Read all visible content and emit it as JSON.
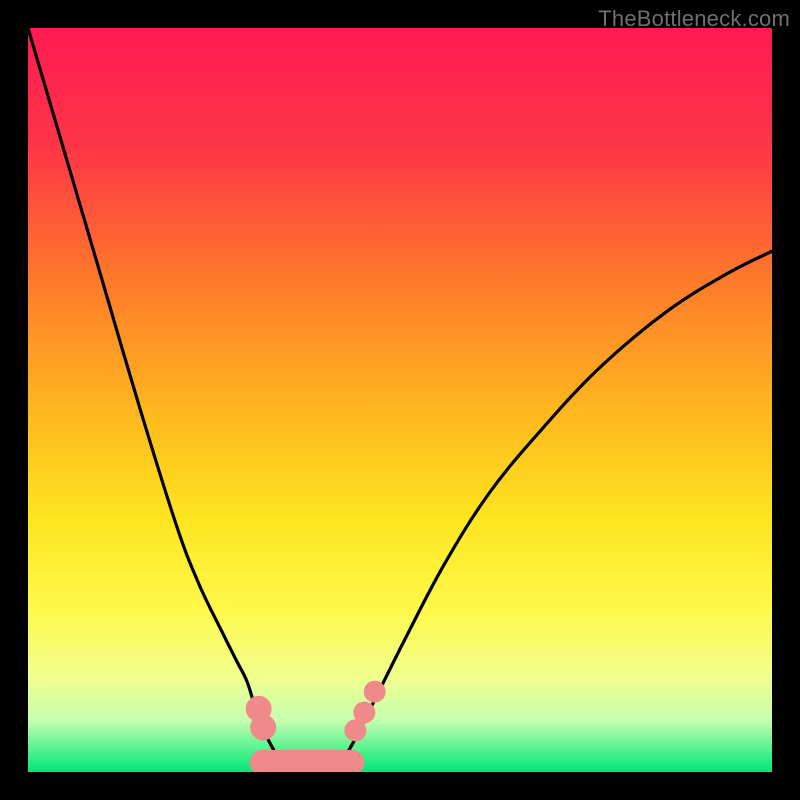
{
  "watermark": "TheBottleneck.com",
  "chart_data": {
    "type": "line",
    "title": "",
    "xlabel": "",
    "ylabel": "",
    "xlim": [
      0,
      1
    ],
    "ylim": [
      0,
      1
    ],
    "background_gradient": {
      "colors": [
        "#ff1a52",
        "#ff6a2e",
        "#ffcf1f",
        "#fff33a",
        "#f4ff8f",
        "#00e676"
      ],
      "direction": "top-to-bottom"
    },
    "series": [
      {
        "name": "left-curve",
        "x": [
          0.0,
          0.05,
          0.1,
          0.15,
          0.2,
          0.23,
          0.26,
          0.28,
          0.295,
          0.31,
          0.33,
          0.345
        ],
        "y": [
          1.0,
          0.83,
          0.66,
          0.49,
          0.33,
          0.252,
          0.19,
          0.15,
          0.12,
          0.072,
          0.03,
          0.01
        ]
      },
      {
        "name": "bottom-flat",
        "x": [
          0.345,
          0.42
        ],
        "y": [
          0.01,
          0.01
        ]
      },
      {
        "name": "right-curve",
        "x": [
          0.42,
          0.44,
          0.47,
          0.51,
          0.56,
          0.62,
          0.69,
          0.77,
          0.86,
          0.94,
          1.0
        ],
        "y": [
          0.01,
          0.045,
          0.105,
          0.185,
          0.28,
          0.375,
          0.46,
          0.545,
          0.62,
          0.67,
          0.7
        ]
      }
    ],
    "markers": {
      "name": "pink-beads",
      "color": "#f08a8a",
      "shape": "circle",
      "points": [
        {
          "x": 0.31,
          "y": 0.085,
          "r": 13
        },
        {
          "x": 0.316,
          "y": 0.06,
          "r": 13
        },
        {
          "x": 0.44,
          "y": 0.056,
          "r": 11
        },
        {
          "x": 0.452,
          "y": 0.08,
          "r": 11
        },
        {
          "x": 0.466,
          "y": 0.108,
          "r": 11
        }
      ],
      "bottom_band": {
        "x0": 0.315,
        "x1": 0.435,
        "y": 0.01,
        "thickness": 0.034
      }
    }
  }
}
